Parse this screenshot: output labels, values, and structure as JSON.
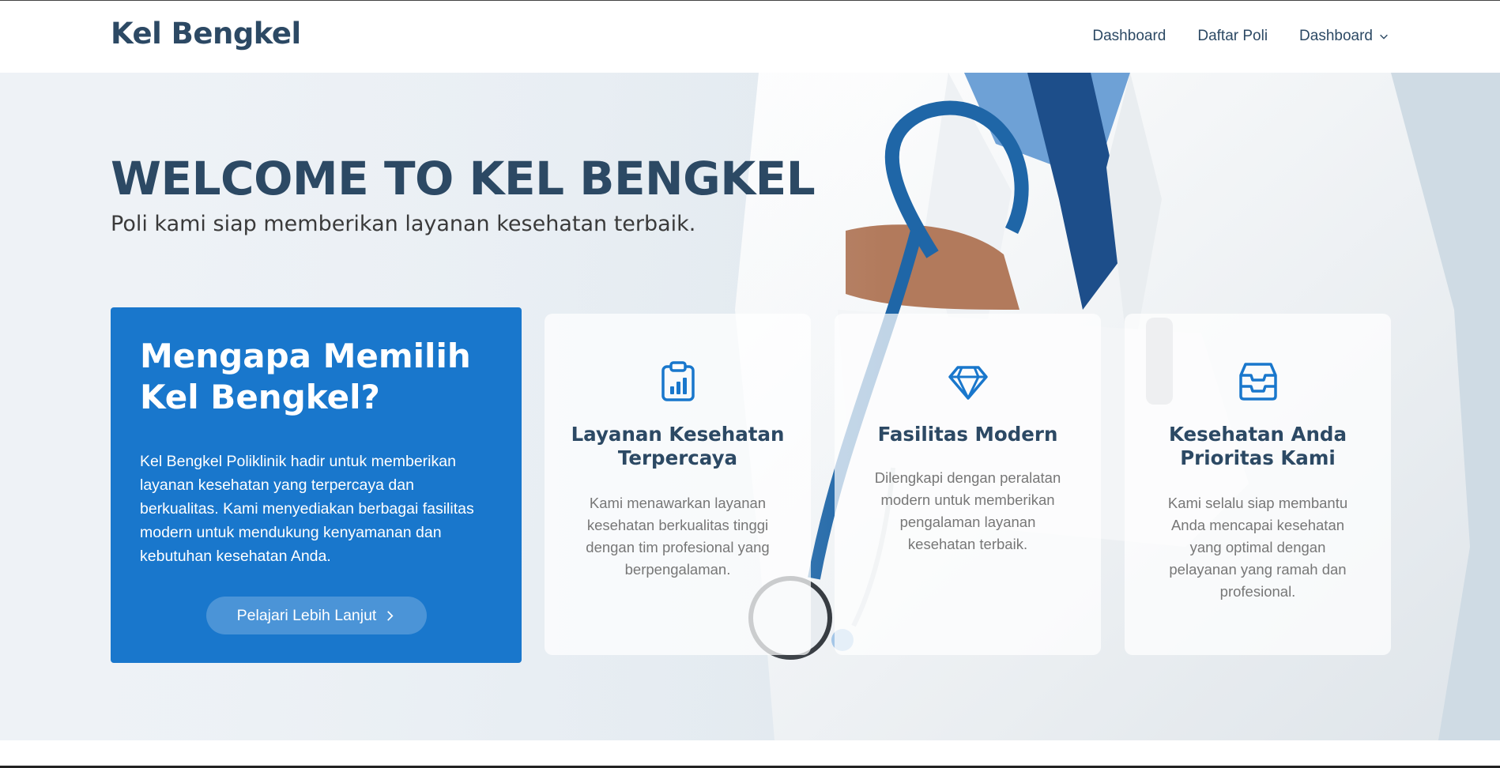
{
  "header": {
    "brand": "Kel Bengkel",
    "nav": [
      {
        "label": "Dashboard"
      },
      {
        "label": "Daftar Poli"
      },
      {
        "label": "Dashboard"
      }
    ]
  },
  "hero": {
    "title": "WELCOME TO KEL BENGKEL",
    "subtitle": "Poli kami siap memberikan layanan kesehatan terbaik."
  },
  "why": {
    "title_line1": "Mengapa Memilih",
    "title_line2": "Kel Bengkel?",
    "text": "Kel Bengkel Poliklinik hadir untuk memberikan layanan kesehatan yang terpercaya dan berkualitas. Kami menyediakan berbagai fasilitas modern untuk mendukung kenyamanan dan kebutuhan kesehatan Anda.",
    "button_label": "Pelajari Lebih Lanjut"
  },
  "cards": [
    {
      "icon": "clipboard-chart-icon",
      "title": "Layanan Kesehatan Terpercaya",
      "text": "Kami menawarkan layanan kesehatan berkualitas tinggi dengan tim profesional yang berpengalaman."
    },
    {
      "icon": "diamond-icon",
      "title": "Fasilitas Modern",
      "text": "Dilengkapi dengan peralatan modern untuk memberikan pengalaman layanan kesehatan terbaik."
    },
    {
      "icon": "inbox-tray-icon",
      "title": "Kesehatan Anda Prioritas Kami",
      "text": "Kami selalu siap membantu Anda mencapai kesehatan yang optimal dengan pelayanan yang ramah dan profesional."
    }
  ],
  "colors": {
    "accent": "#1977cc",
    "heading": "#2c4964",
    "muted_text": "#777777"
  }
}
